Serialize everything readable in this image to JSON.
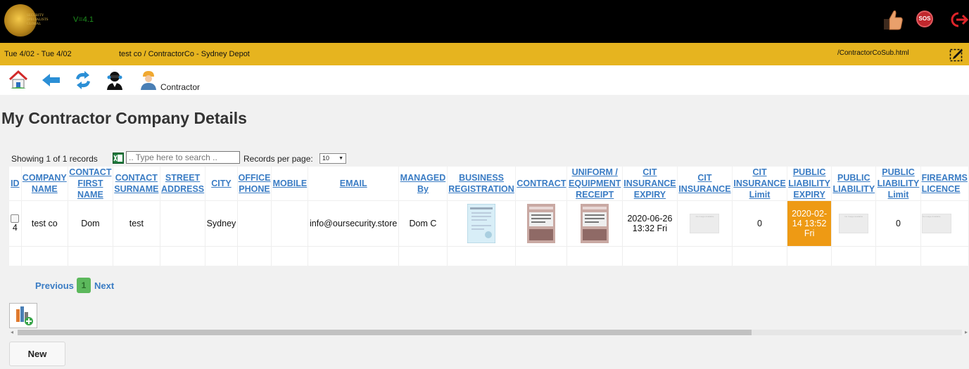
{
  "header": {
    "version": "V=4.1",
    "logo_text": "SECURITY SPECIALISTS GLOBAL",
    "sos_label": "SOS"
  },
  "infobar": {
    "date_range": "Tue 4/02 - Tue 4/02",
    "company_path": "test co / ContractorCo - Sydney Depot",
    "page_path": "/ContractorCoSub.html"
  },
  "toolbar": {
    "contractor_label": "Contractor"
  },
  "page": {
    "title": "My Contractor Company Details"
  },
  "controls": {
    "showing": "Showing 1 of 1 records",
    "search_placeholder": ".. Type here to search ..",
    "records_per_page_label": "Records per page:",
    "records_per_page_value": "10"
  },
  "table": {
    "headers": {
      "id": "ID",
      "company_name": "COMPANY NAME",
      "contact_first_name": "CONTACT FIRST NAME",
      "contact_surname": "CONTACT SURNAME",
      "street_address": "STREET ADDRESS",
      "city": "CITY",
      "office_phone": "OFFICE PHONE",
      "mobile": "MOBILE",
      "email": "EMAIL",
      "managed_by": "MANAGED By",
      "business_registration": "BUSINESS REGISTRATION",
      "contract": "CONTRACT",
      "uniform_receipt": "UNIFORM / EQUIPMENT RECEIPT",
      "cit_insurance_expiry": "CIT INSURANCE EXPIRY",
      "cit_insurance": "CIT INSURANCE",
      "cit_insurance_limit": "CIT INSURANCE Limit",
      "public_liability_expiry": "PUBLIC LIABILITY EXPIRY",
      "public_liability": "PUBLIC LIABILITY",
      "public_liability_limit": "PUBLIC LIABILITY Limit",
      "firearms_licence": "FIREARMS LICENCE"
    },
    "rows": [
      {
        "id": "4",
        "company_name": "test co",
        "contact_first_name": "Dom",
        "contact_surname": "test",
        "street_address": "",
        "city": "Sydney",
        "office_phone": "",
        "mobile": "",
        "email": "info@oursecurity.store",
        "managed_by": "Dom C",
        "cit_insurance_expiry": "2020-06-26 13:32 Fri",
        "cit_insurance_limit": "0",
        "public_liability_expiry": "2020-02-14 13:52 Fri",
        "public_liability_limit": "0",
        "no_image_text": "No Image Available"
      }
    ]
  },
  "pagination": {
    "previous": "Previous",
    "current_page": "1",
    "next": "Next"
  },
  "actions": {
    "new_label": "New"
  },
  "colors": {
    "topbar": "#000000",
    "infobar": "#e6b41f",
    "link": "#3a7cc4",
    "expiry_highlight": "#ee9a14",
    "pager_active": "#5cb85c"
  },
  "icons": {
    "logo": "company-logo",
    "thumb": "thumbs-up-icon",
    "sos": "sos-icon",
    "logout": "logout-icon",
    "edit": "edit-page-icon",
    "home": "home-icon",
    "back": "back-arrow-icon",
    "refresh": "refresh-icon",
    "support": "support-agent-icon",
    "contractor": "contractor-icon",
    "excel": "excel-export-icon",
    "add_report": "add-report-icon"
  }
}
